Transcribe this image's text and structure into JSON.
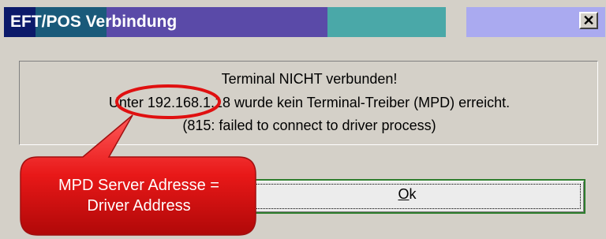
{
  "window": {
    "title": "EFT/POS Verbindung",
    "close_symbol": "✕",
    "titlebar_colors": [
      "#0c1a6a",
      "#1a5a7a",
      "#5a4aa8",
      "#4aa8a8",
      "#d4d0c8",
      "#aaaaf0"
    ]
  },
  "message": {
    "line1": "Terminal NICHT verbunden!",
    "line2_prefix": "Unter ",
    "line2_ip": "192.168.1.18",
    "line2_suffix": " wurde kein Terminal-Treiber (MPD) erreicht.",
    "line3": "(815: failed to connect to driver process)"
  },
  "buttons": {
    "ok_label": "Ok"
  },
  "annotation": {
    "callout_line1": "MPD Server Adresse =",
    "callout_line2": "Driver Address",
    "highlight_color": "#e01010"
  }
}
